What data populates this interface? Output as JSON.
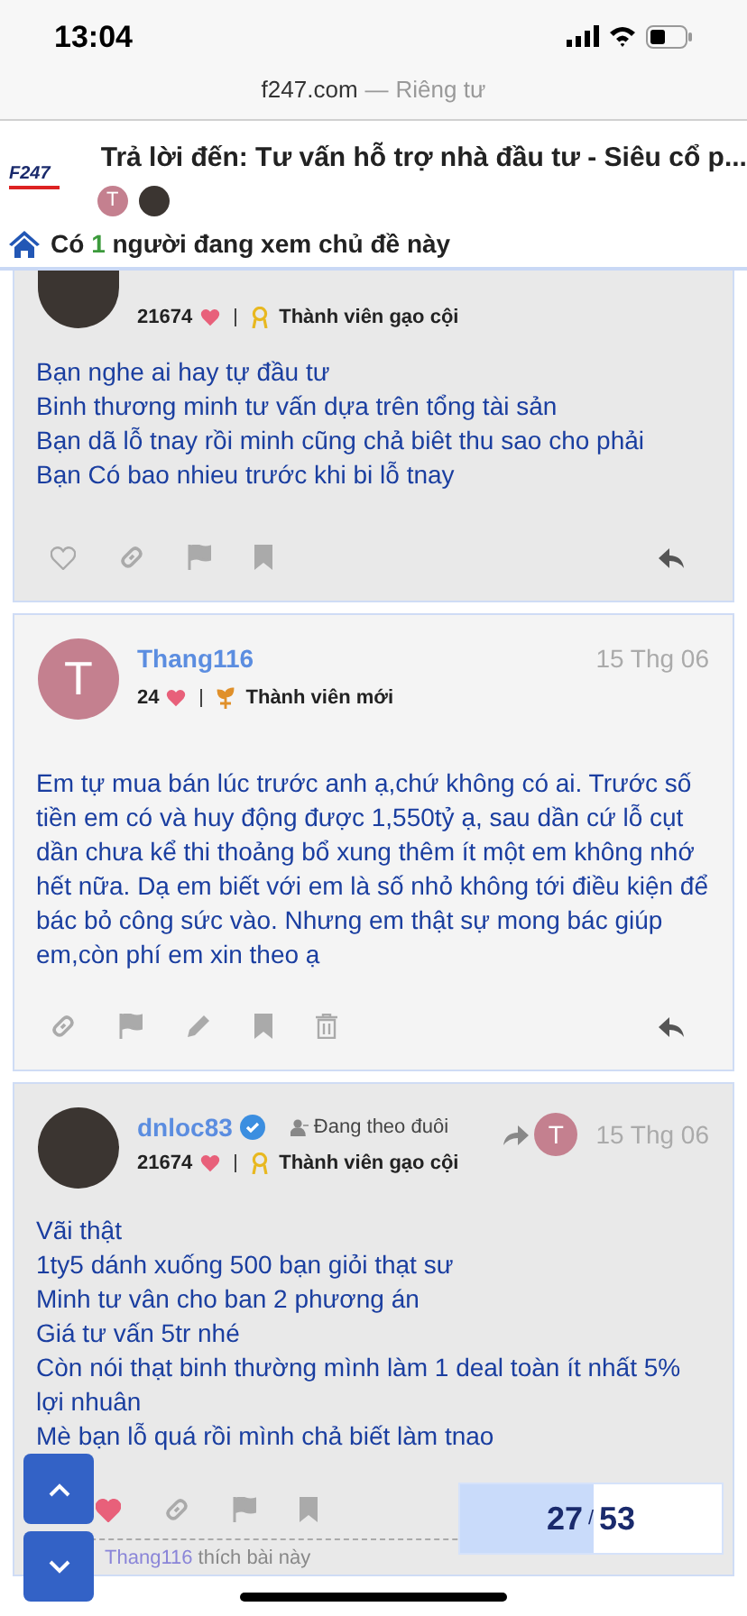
{
  "status_bar": {
    "time": "13:04"
  },
  "browser": {
    "domain": "f247.com",
    "separator": "—",
    "mode": "Riêng tư"
  },
  "topic": {
    "logo": "F247",
    "title": "Trả lời đến: Tư vấn hỗ trợ nhà đầu tư - Siêu cổ p...",
    "participants": [
      {
        "kind": "letter",
        "letter": "T",
        "color": "#c4808f"
      },
      {
        "kind": "photo"
      }
    ]
  },
  "viewers": {
    "prefix": "Có",
    "count": "1",
    "suffix": "người đang xem chủ đề này"
  },
  "posts": [
    {
      "kind": "partial",
      "avatar": {
        "kind": "photo"
      },
      "score": "21674",
      "rank": "Thành viên gạo cội",
      "rank_badge": {
        "kind": "medal"
      },
      "lines": [
        "Bạn nghe ai hay tự đầu tư",
        "Binh thương minh tư vấn dựa trên tổng tài sản",
        "Bạn dã lỗ tnay rồi minh cũng chả biêt thu sao cho phải",
        "Bạn Có bao nhieu trước khi bi lỗ tnay"
      ],
      "actions": [
        {
          "kind": "like"
        },
        {
          "kind": "link"
        },
        {
          "kind": "flag"
        },
        {
          "kind": "bookmark"
        }
      ],
      "liked": false
    },
    {
      "kind": "full",
      "avatar": {
        "kind": "letter",
        "letter": "T",
        "color": "#c4808f"
      },
      "username": "Thang116",
      "date": "15 Thg 06",
      "score": "24",
      "rank": "Thành viên mới",
      "rank_badge": {
        "kind": "sprout"
      },
      "lines": [
        "Em tự mua bán lúc trước anh ạ,chứ không có ai. Trước số tiền em có và huy động được 1,550tỷ ạ, sau dần cứ lỗ cụt dần chưa kể thi thoảng bổ xung thêm ít một em không nhớ hết nữa. Dạ em biết với em là số nhỏ không tới điều kiện để bác bỏ công sức vào. Nhưng em thật sự mong bác giúp em,còn phí em xin theo ạ"
      ],
      "actions": [
        {
          "kind": "link"
        },
        {
          "kind": "flag"
        },
        {
          "kind": "edit"
        },
        {
          "kind": "bookmark"
        },
        {
          "kind": "delete"
        }
      ]
    },
    {
      "kind": "full",
      "avatar": {
        "kind": "photo"
      },
      "username": "dnloc83",
      "verified": true,
      "following": "Đang theo đuôi",
      "reply_to": {
        "letter": "T",
        "color": "#c4808f"
      },
      "date": "15 Thg 06",
      "score": "21674",
      "rank": "Thành viên gạo cội",
      "rank_badge": {
        "kind": "medal"
      },
      "lines": [
        "Vãi thật",
        "1ty5 dánh xuống 500 bạn giỏi thạt sư",
        "Minh tư vân cho ban 2 phương án",
        "Giá tư vấn 5tr nhé",
        "Còn nói thạt binh thường mình làm 1 deal toàn ít nhất 5% lợi nhuân",
        "Mè bạn lỗ quá rồi mình chả biết làm tnao"
      ],
      "actions": [
        {
          "kind": "like"
        },
        {
          "kind": "link"
        },
        {
          "kind": "flag"
        },
        {
          "kind": "bookmark"
        }
      ],
      "liked": true,
      "liked_by": {
        "user": "Thang116",
        "text": "thích bài này"
      }
    }
  ],
  "progress": {
    "current": "27",
    "separator": "/",
    "total": "53",
    "level": 0.51
  }
}
